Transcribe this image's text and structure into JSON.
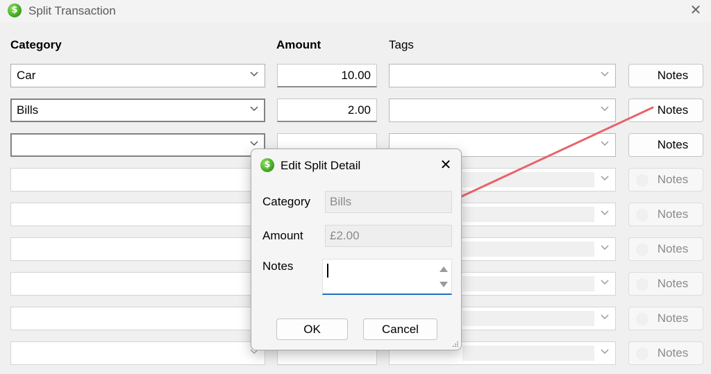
{
  "window": {
    "title": "Split Transaction",
    "icon": "dollar-icon",
    "close_glyph": "✕"
  },
  "headers": {
    "category": "Category",
    "amount": "Amount",
    "tags": "Tags"
  },
  "rows": [
    {
      "category": "Car",
      "amount": "10.00",
      "tags": "",
      "notes_label": "Notes",
      "enabled": true
    },
    {
      "category": "Bills",
      "amount": "2.00",
      "tags": "",
      "notes_label": "Notes",
      "enabled": true
    },
    {
      "category": "",
      "amount": "",
      "tags": "",
      "notes_label": "Notes",
      "enabled": true
    },
    {
      "category": "",
      "amount": "",
      "tags": "",
      "notes_label": "Notes",
      "enabled": false
    },
    {
      "category": "",
      "amount": "",
      "tags": "",
      "notes_label": "Notes",
      "enabled": false
    },
    {
      "category": "",
      "amount": "",
      "tags": "",
      "notes_label": "Notes",
      "enabled": false
    },
    {
      "category": "",
      "amount": "",
      "tags": "",
      "notes_label": "Notes",
      "enabled": false
    },
    {
      "category": "",
      "amount": "",
      "tags": "",
      "notes_label": "Notes",
      "enabled": false
    },
    {
      "category": "",
      "amount": "",
      "tags": "",
      "notes_label": "Notes",
      "enabled": false
    }
  ],
  "dialog": {
    "title": "Edit Split Detail",
    "close_glyph": "✕",
    "category_label": "Category",
    "category_value": "Bills",
    "amount_label": "Amount",
    "amount_value": "£2.00",
    "notes_label": "Notes",
    "notes_value": "",
    "ok_label": "OK",
    "cancel_label": "Cancel"
  },
  "colors": {
    "annotation_arrow": "#e8626b",
    "focus_underline": "#1f6fc5",
    "app_icon_green": "#3aa01c"
  }
}
